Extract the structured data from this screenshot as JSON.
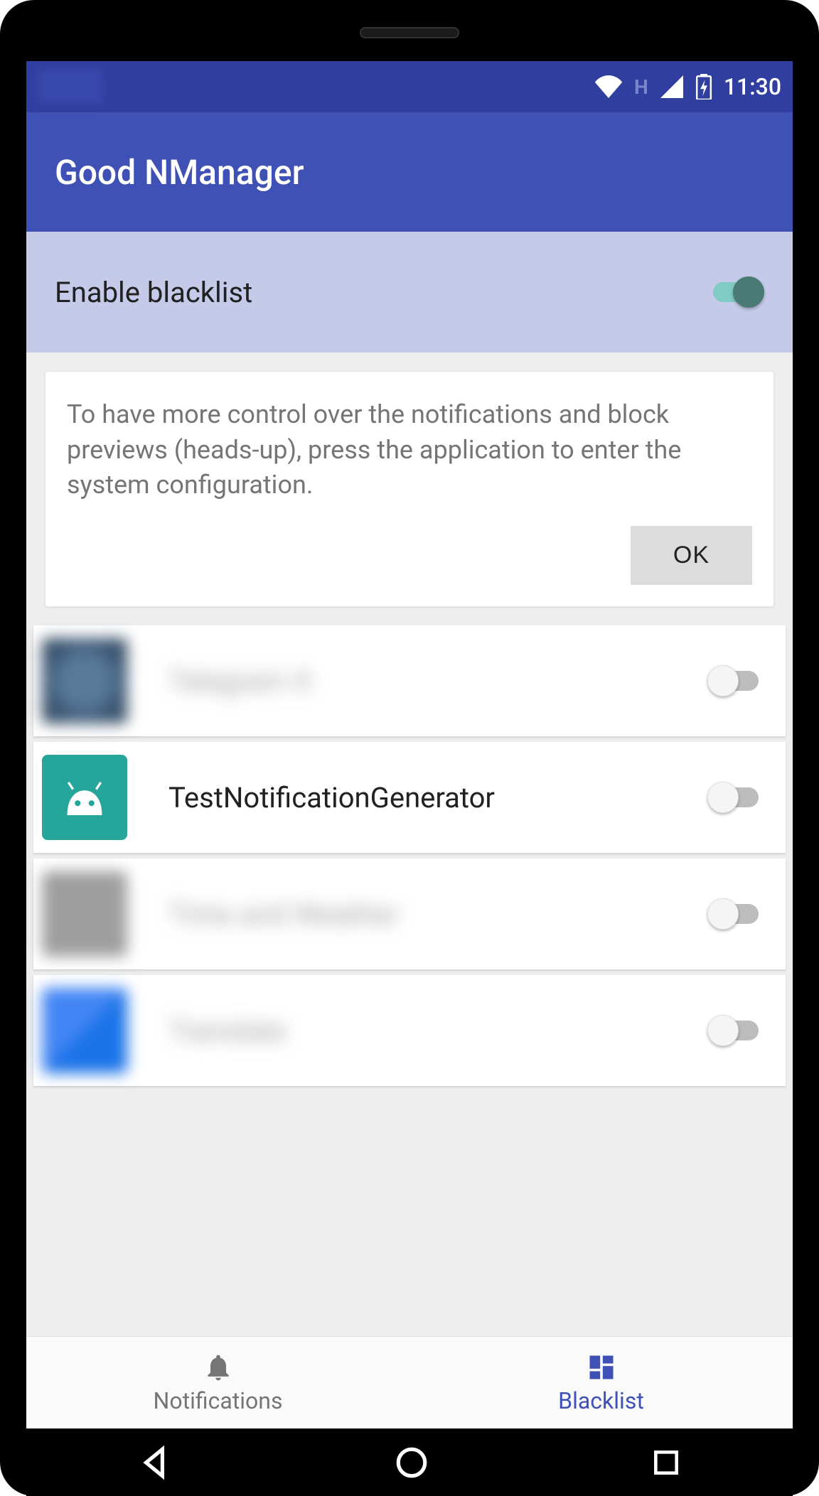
{
  "status": {
    "network_indicator": "H",
    "time": "11:30"
  },
  "app_bar": {
    "title": "Good NManager"
  },
  "enable_blacklist": {
    "label": "Enable blacklist",
    "enabled": true
  },
  "info_card": {
    "message": "To have more control over the notifications and block previews (heads-up), press the application to enter the system configuration.",
    "ok_label": "OK"
  },
  "apps": [
    {
      "name": "Telegram X",
      "blocked": false,
      "blurred": true,
      "icon": "circle"
    },
    {
      "name": "TestNotificationGenerator",
      "blocked": false,
      "blurred": false,
      "icon": "android"
    },
    {
      "name": "Time and Weather",
      "blocked": false,
      "blurred": true,
      "icon": "grey"
    },
    {
      "name": "Translate",
      "blocked": false,
      "blurred": true,
      "icon": "blue"
    }
  ],
  "bottom_nav": {
    "notifications_label": "Notifications",
    "blacklist_label": "Blacklist",
    "active": "blacklist"
  }
}
